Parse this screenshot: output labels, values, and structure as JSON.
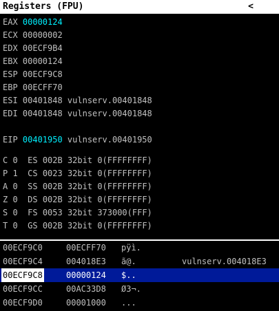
{
  "title": "Registers (FPU)",
  "collapse_glyph": "<",
  "registers": [
    {
      "name": "EAX",
      "value": "00000124",
      "comment": "",
      "highlight": true
    },
    {
      "name": "ECX",
      "value": "00000002",
      "comment": "",
      "highlight": false
    },
    {
      "name": "EDX",
      "value": "00ECF9B4",
      "comment": "",
      "highlight": false
    },
    {
      "name": "EBX",
      "value": "00000124",
      "comment": "",
      "highlight": false
    },
    {
      "name": "ESP",
      "value": "00ECF9C8",
      "comment": "",
      "highlight": false
    },
    {
      "name": "EBP",
      "value": "00ECFF70",
      "comment": "",
      "highlight": false
    },
    {
      "name": "ESI",
      "value": "00401848",
      "comment": "vulnserv.00401848",
      "highlight": false
    },
    {
      "name": "EDI",
      "value": "00401848",
      "comment": "vulnserv.00401848",
      "highlight": false
    }
  ],
  "eip": {
    "name": "EIP",
    "value": "00401950",
    "comment": "vulnserv.00401950",
    "highlight": true
  },
  "flags": [
    {
      "flag": "C",
      "val": "0",
      "seg": "ES",
      "selector": "002B",
      "bits": "32bit",
      "base": "0(FFFFFFFF)"
    },
    {
      "flag": "P",
      "val": "1",
      "seg": "CS",
      "selector": "0023",
      "bits": "32bit",
      "base": "0(FFFFFFFF)"
    },
    {
      "flag": "A",
      "val": "0",
      "seg": "SS",
      "selector": "002B",
      "bits": "32bit",
      "base": "0(FFFFFFFF)"
    },
    {
      "flag": "Z",
      "val": "0",
      "seg": "DS",
      "selector": "002B",
      "bits": "32bit",
      "base": "0(FFFFFFFF)"
    },
    {
      "flag": "S",
      "val": "0",
      "seg": "FS",
      "selector": "0053",
      "bits": "32bit",
      "base": "373000(FFF)"
    },
    {
      "flag": "T",
      "val": "0",
      "seg": "GS",
      "selector": "002B",
      "bits": "32bit",
      "base": "0(FFFFFFFF)"
    }
  ],
  "stack": [
    {
      "addr": "00ECF9C0",
      "value": "00ECFF70",
      "ascii": "pÿì.",
      "comment": "",
      "selected": false
    },
    {
      "addr": "00ECF9C4",
      "value": "004018E3",
      "ascii": "ã\u0018@.",
      "comment": "vulnserv.004018E3",
      "selected": false
    },
    {
      "addr": "00ECF9C8",
      "value": "00000124",
      "ascii": "$\u0001..",
      "comment": "",
      "selected": true
    },
    {
      "addr": "00ECF9CC",
      "value": "00AC33D8",
      "ascii": "Ø3¬.",
      "comment": "",
      "selected": false
    },
    {
      "addr": "00ECF9D0",
      "value": "00001000",
      "ascii": ".\u0010..",
      "comment": "",
      "selected": false
    }
  ]
}
